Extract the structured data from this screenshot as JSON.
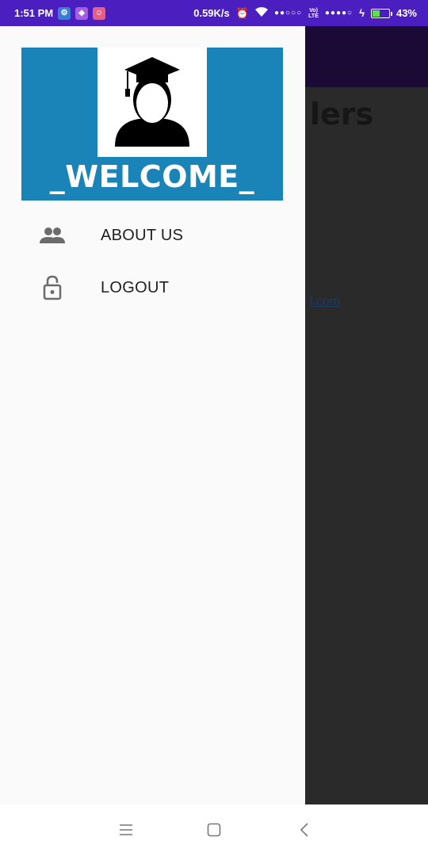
{
  "status_bar": {
    "time": "1:51 PM",
    "net_speed": "0.59K/s",
    "sim1_dots": "●●○○○",
    "lte_top": "Vo)",
    "lte_bottom": "LTE",
    "sim2_dots": "●●●●○",
    "battery": "43%",
    "battery_level_percent": 43,
    "background_color": "#4b1fbf"
  },
  "background_screen": {
    "heading_fragment": "lers",
    "link_fragment": "l.com"
  },
  "drawer": {
    "header_color": "#1a84b8",
    "welcome_text": "_WELCOME_",
    "items": [
      {
        "label": "ABOUT US",
        "icon": "people-icon"
      },
      {
        "label": "LOGOUT",
        "icon": "lock-icon"
      }
    ]
  },
  "nav_bar": {
    "buttons": [
      "menu-icon",
      "home-icon",
      "back-icon"
    ]
  }
}
